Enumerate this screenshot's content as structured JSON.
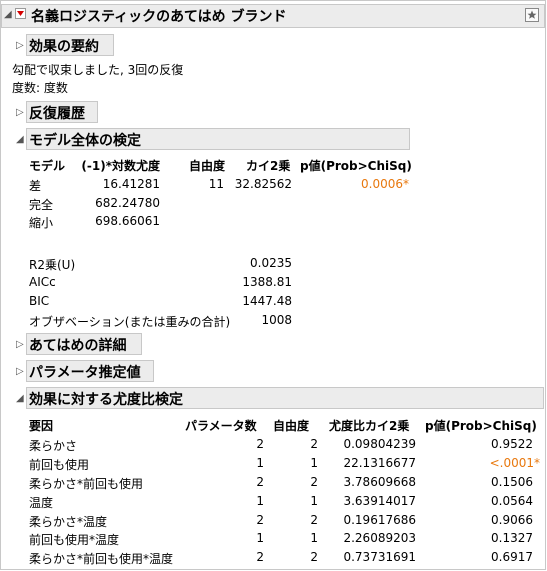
{
  "title": "名義ロジスティックのあてはめ ブランド",
  "sections": {
    "summary": "効果の要約",
    "iterations": "反復履歴",
    "whole_model": "モデル全体の検定",
    "fit_details": "あてはめの詳細",
    "param_est": "パラメータ推定値",
    "lr_tests": "効果に対する尤度比検定"
  },
  "convergence_line": "勾配で収束しました, 3回の反復",
  "frequency_line": "度数: 度数",
  "whole_model": {
    "headers": [
      "モデル",
      "(-1)*対数尤度",
      "自由度",
      "カイ2乗",
      "p値(Prob>ChiSq)"
    ],
    "rows": [
      {
        "model": "差",
        "loglik": "16.41281",
        "df": "11",
        "chisq": "32.82562",
        "p": "0.0006*"
      },
      {
        "model": "完全",
        "loglik": "682.24780",
        "df": "",
        "chisq": "",
        "p": ""
      },
      {
        "model": "縮小",
        "loglik": "698.66061",
        "df": "",
        "chisq": "",
        "p": ""
      }
    ],
    "stats": [
      {
        "label": "R2乗(U)",
        "value": "0.0235"
      },
      {
        "label": "AICc",
        "value": "1388.81"
      },
      {
        "label": "BIC",
        "value": "1447.48"
      },
      {
        "label": "オブザベーション(または重みの合計)",
        "value": "1008"
      }
    ]
  },
  "lr_table": {
    "headers": [
      "要因",
      "パラメータ数",
      "自由度",
      "尤度比カイ2乗",
      "p値(Prob>ChiSq)"
    ],
    "rows": [
      {
        "source": "柔らかさ",
        "nparm": "2",
        "df": "2",
        "chisq": "0.09804239",
        "p": "0.9522"
      },
      {
        "source": "前回も使用",
        "nparm": "1",
        "df": "1",
        "chisq": "22.1316677",
        "p": "<.0001*"
      },
      {
        "source": "柔らかさ*前回も使用",
        "nparm": "2",
        "df": "2",
        "chisq": "3.78609668",
        "p": "0.1506"
      },
      {
        "source": "温度",
        "nparm": "1",
        "df": "1",
        "chisq": "3.63914017",
        "p": "0.0564"
      },
      {
        "source": "柔らかさ*温度",
        "nparm": "2",
        "df": "2",
        "chisq": "0.19617686",
        "p": "0.9066"
      },
      {
        "source": "前回も使用*温度",
        "nparm": "1",
        "df": "1",
        "chisq": "2.26089203",
        "p": "0.1327"
      },
      {
        "source": "柔らかさ*前回も使用*温度",
        "nparm": "2",
        "df": "2",
        "chisq": "0.73731691",
        "p": "0.6917"
      }
    ]
  }
}
